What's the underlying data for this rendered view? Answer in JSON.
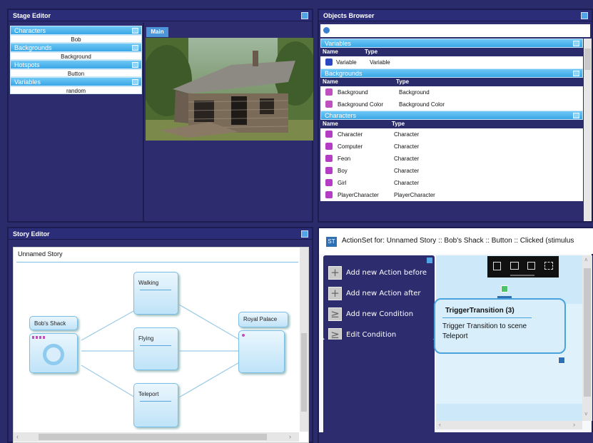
{
  "stage_editor": {
    "title": "Stage Editor",
    "sections": [
      {
        "header": "Characters",
        "value": "Bob"
      },
      {
        "header": "Backgrounds",
        "value": "Background"
      },
      {
        "header": "Hotspots",
        "value": "Button"
      },
      {
        "header": "Variables",
        "value": "random"
      }
    ],
    "tab_main": "Main"
  },
  "objects_browser": {
    "title": "Objects Browser",
    "col_name": "Name",
    "col_type": "Type",
    "groups": [
      {
        "header": "Variables",
        "icon_color": "#2b48c2",
        "rows": [
          {
            "name": "Variable",
            "type": "Variable"
          }
        ]
      },
      {
        "header": "Backgrounds",
        "icon_color": "#c04fbf",
        "rows": [
          {
            "name": "Background",
            "type": "Background"
          },
          {
            "name": "Background Color",
            "type": "Background Color"
          }
        ]
      },
      {
        "header": "Characters",
        "icon_color": "#b53cc4",
        "rows": [
          {
            "name": "Character",
            "type": "Character"
          },
          {
            "name": "Computer",
            "type": "Character"
          },
          {
            "name": "Feon",
            "type": "Character"
          },
          {
            "name": "Boy",
            "type": "Character"
          },
          {
            "name": "Girl",
            "type": "Character"
          },
          {
            "name": "PlayerCharacter",
            "type": "PlayerCharacter"
          }
        ]
      }
    ]
  },
  "story_editor": {
    "title": "Story Editor",
    "story_name": "Unnamed Story",
    "nodes": {
      "bobs_shack": "Bob's Shack",
      "walking": "Walking",
      "flying": "Flying",
      "teleport": "Teleport",
      "royal_palace": "Royal Palace"
    }
  },
  "action_set": {
    "badge": "ST",
    "title": "ActionSet for: Unnamed Story :: Bob's Shack :: Button :: Clicked (stimulus",
    "menu": [
      {
        "label": "Add new Action before",
        "icon": "+"
      },
      {
        "label": "Add new Action after",
        "icon": "+"
      },
      {
        "label": "Add new Condition",
        "icon": "≥"
      },
      {
        "label": "Edit Condition",
        "icon": "≥"
      }
    ],
    "card": {
      "title": "TriggerTransition (3)",
      "desc": "Trigger Transition to scene Teleport"
    }
  }
}
